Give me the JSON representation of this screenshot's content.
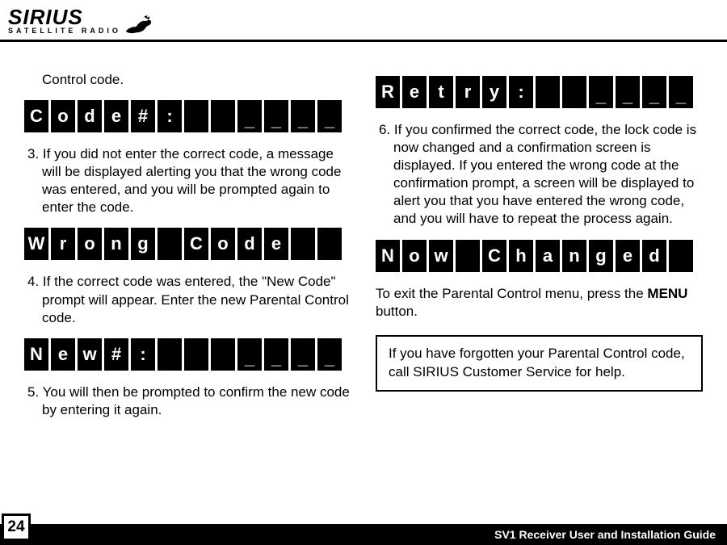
{
  "logo": {
    "main": "SIRIUS",
    "sub": "SATELLITE  RADIO"
  },
  "col1": {
    "p0": "Control code.",
    "lcd1": [
      "C",
      "o",
      "d",
      "e",
      "#",
      ":",
      "",
      "",
      "_",
      "_",
      "_",
      "_"
    ],
    "p1": "3. If you did not enter the correct code, a message will be displayed alerting you that the wrong code was entered, and you will be prompted again to enter the code.",
    "lcd2": [
      "W",
      "r",
      "o",
      "n",
      "g",
      "",
      "C",
      "o",
      "d",
      "e",
      "",
      ""
    ],
    "p2": "4. If the correct code was entered, the \"New Code\" prompt will appear. Enter the new Parental Control code.",
    "lcd3": [
      "N",
      "e",
      "w",
      "#",
      ":",
      "",
      "",
      "",
      "_",
      "_",
      "_",
      "_"
    ],
    "p3": "5. You will then be prompted to confirm the new code by entering it again."
  },
  "col2": {
    "lcd4": [
      "R",
      "e",
      "t",
      "r",
      "y",
      ":",
      "",
      "",
      "_",
      "_",
      "_",
      "_"
    ],
    "p4": "6. If you confirmed the correct code, the lock code is now changed and a confirmation screen is displayed. If you entered the wrong code at the confirmation prompt, a screen will be displayed to alert you that you have entered the wrong code, and you will have to repeat the process again.",
    "lcd5": [
      "N",
      "o",
      "w",
      "",
      "C",
      "h",
      "a",
      "n",
      "g",
      "e",
      "d",
      ""
    ],
    "p5a": "To exit the Parental Control menu, press the ",
    "p5b": "MENU",
    "p5c": " button.",
    "note": "If you have forgotten your Parental Control code, call SIRIUS Customer Service for help."
  },
  "footer": {
    "guide": "SV1 Receiver User and Installation Guide",
    "page": "24"
  }
}
